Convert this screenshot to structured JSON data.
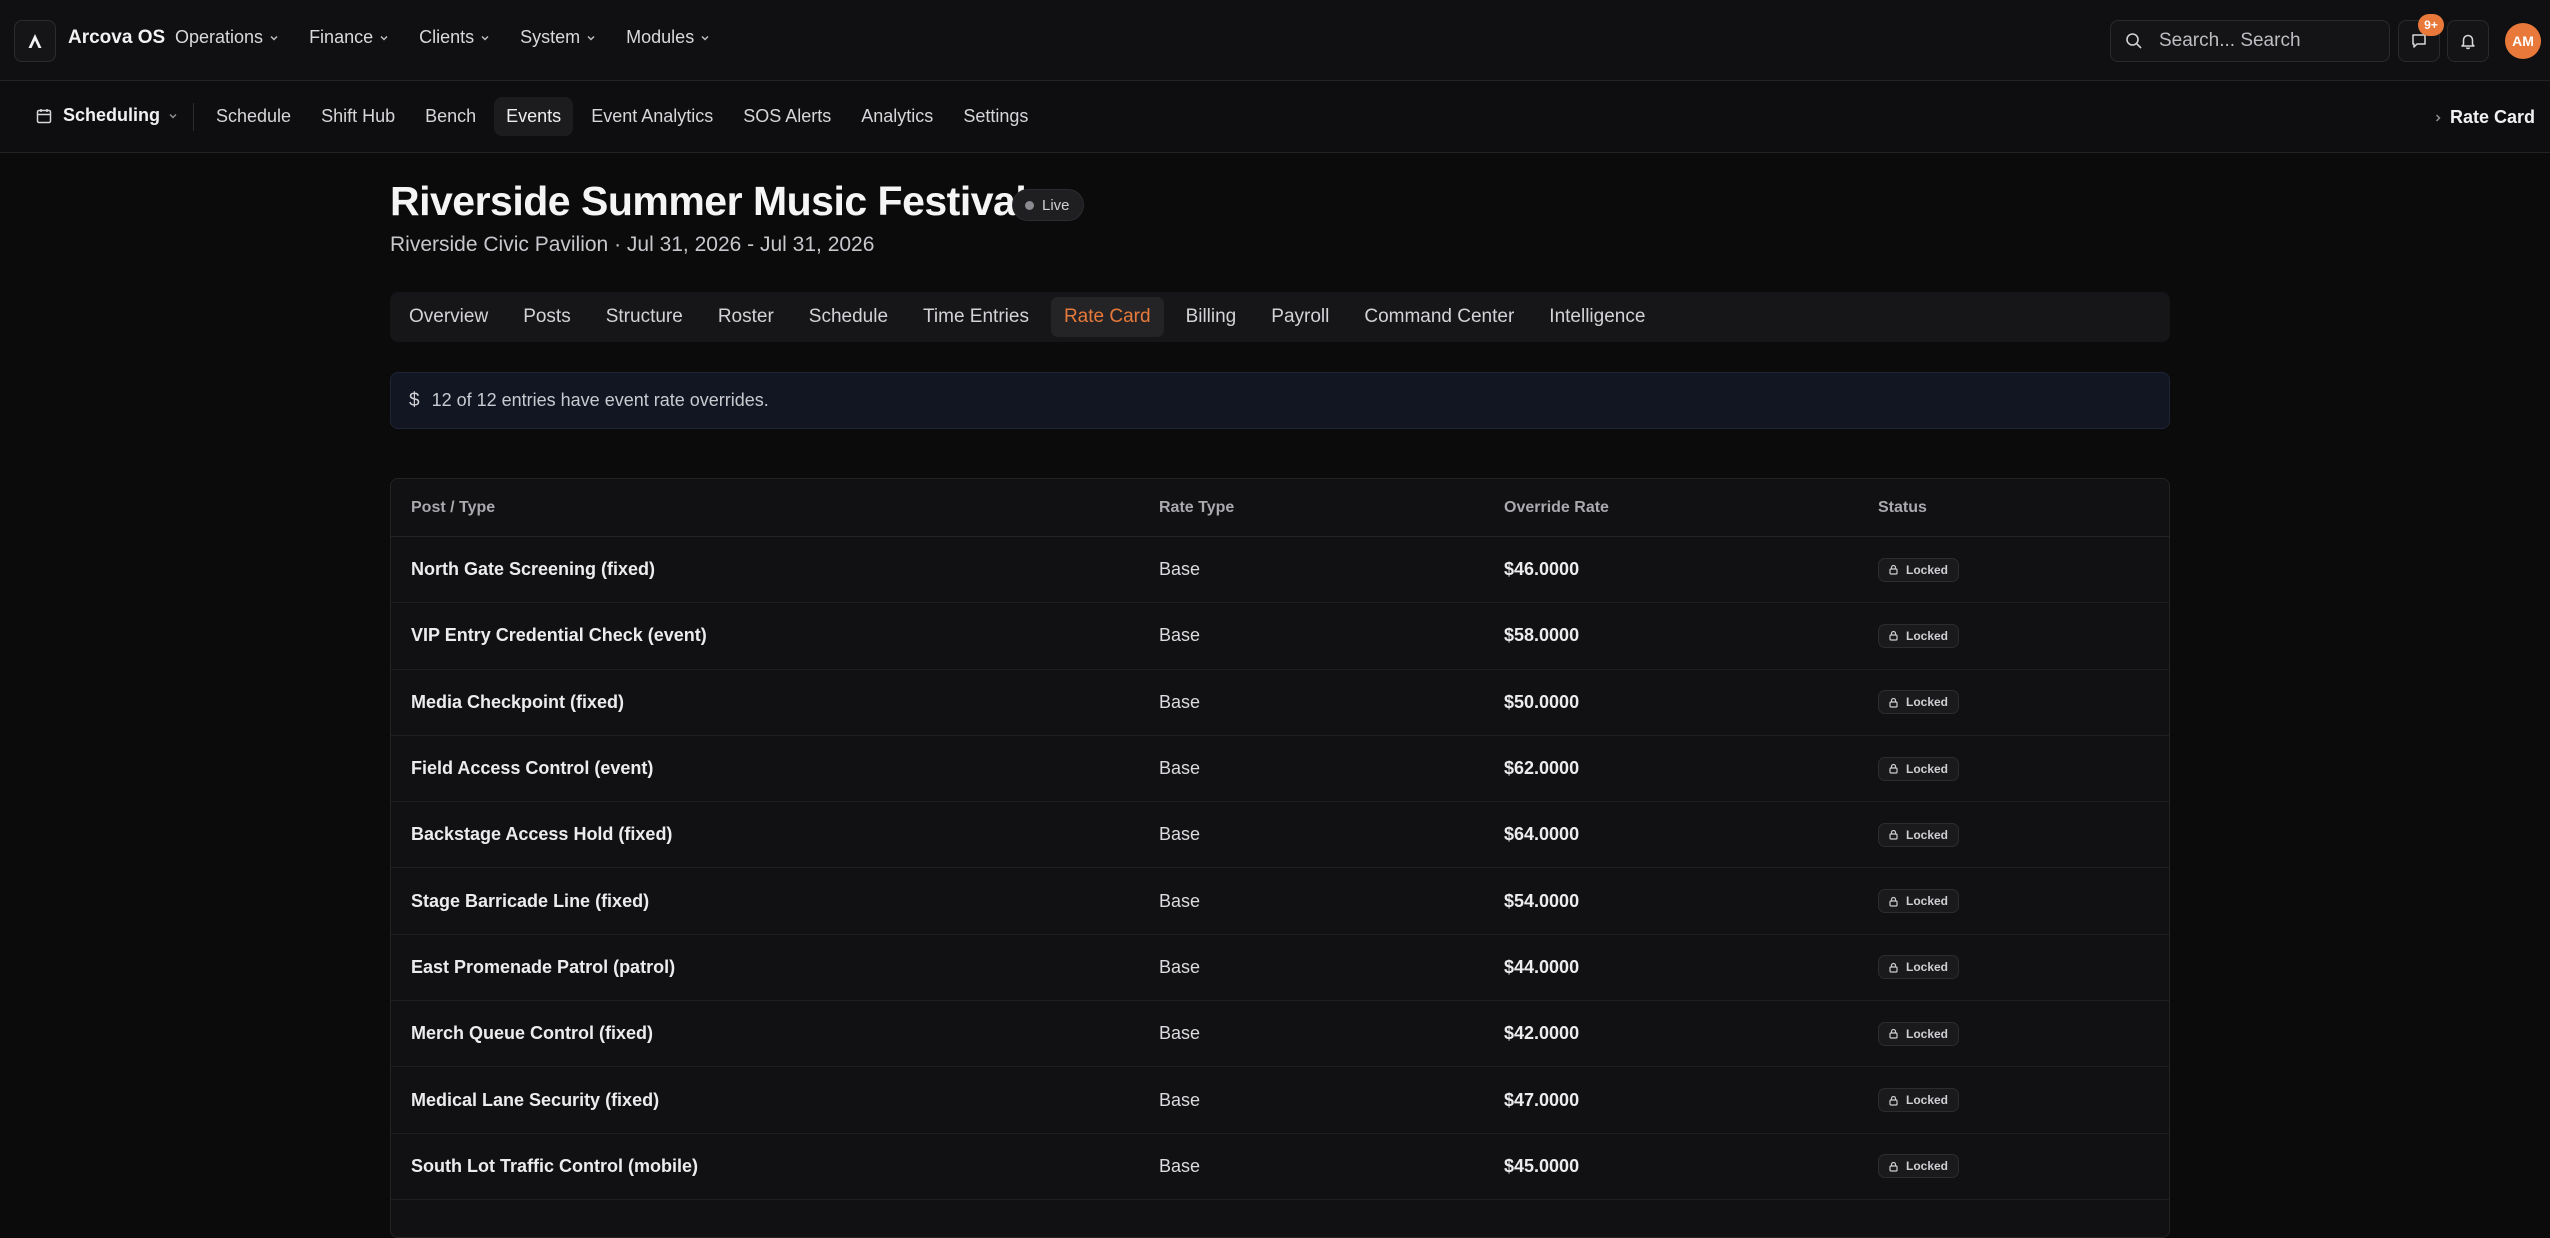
{
  "app": {
    "brand": "Arcova OS",
    "top_nav": [
      "Operations",
      "Finance",
      "Clients",
      "System",
      "Modules"
    ],
    "search_placeholder": "Search... Search",
    "messages_badge": "9+",
    "avatar_initials": "AM"
  },
  "subnav": {
    "module": "Scheduling",
    "items": [
      "Schedule",
      "Shift Hub",
      "Bench",
      "Events",
      "Event Analytics",
      "SOS Alerts",
      "Analytics",
      "Settings"
    ],
    "active": "Events",
    "breadcrumb": "Rate Card"
  },
  "event": {
    "title": "Riverside Summer Music Festival",
    "status": "Live",
    "subtitle": "Riverside Civic Pavilion · Jul 31, 2026 - Jul 31, 2026"
  },
  "tabs": {
    "items": [
      "Overview",
      "Posts",
      "Structure",
      "Roster",
      "Schedule",
      "Time Entries",
      "Rate Card",
      "Billing",
      "Payroll",
      "Command Center",
      "Intelligence"
    ],
    "active": "Rate Card"
  },
  "info": {
    "icon": "dollar-icon",
    "message": "12 of 12 entries have event rate overrides."
  },
  "table": {
    "columns": [
      "Post / Type",
      "Rate Type",
      "Override Rate",
      "Status"
    ],
    "rows": [
      {
        "post": "North Gate Screening (fixed)",
        "rate_type": "Base",
        "rate": "$46.0000",
        "status": "Locked"
      },
      {
        "post": "VIP Entry Credential Check (event)",
        "rate_type": "Base",
        "rate": "$58.0000",
        "status": "Locked"
      },
      {
        "post": "Media Checkpoint (fixed)",
        "rate_type": "Base",
        "rate": "$50.0000",
        "status": "Locked"
      },
      {
        "post": "Field Access Control (event)",
        "rate_type": "Base",
        "rate": "$62.0000",
        "status": "Locked"
      },
      {
        "post": "Backstage Access Hold (fixed)",
        "rate_type": "Base",
        "rate": "$64.0000",
        "status": "Locked"
      },
      {
        "post": "Stage Barricade Line (fixed)",
        "rate_type": "Base",
        "rate": "$54.0000",
        "status": "Locked"
      },
      {
        "post": "East Promenade Patrol (patrol)",
        "rate_type": "Base",
        "rate": "$44.0000",
        "status": "Locked"
      },
      {
        "post": "Merch Queue Control (fixed)",
        "rate_type": "Base",
        "rate": "$42.0000",
        "status": "Locked"
      },
      {
        "post": "Medical Lane Security (fixed)",
        "rate_type": "Base",
        "rate": "$47.0000",
        "status": "Locked"
      },
      {
        "post": "South Lot Traffic Control (mobile)",
        "rate_type": "Base",
        "rate": "$45.0000",
        "status": "Locked"
      }
    ]
  },
  "colors": {
    "accent": "#e8793a",
    "background": "#0b0b0c",
    "info_bg": "#121623"
  }
}
